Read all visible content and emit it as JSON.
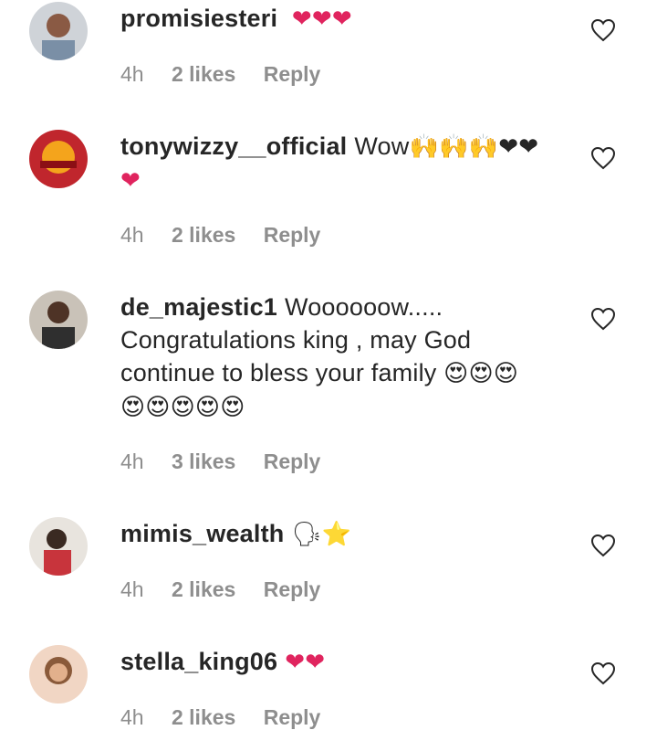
{
  "comments": [
    {
      "username": "promisiesteri",
      "text": "",
      "emoji": "❤❤❤",
      "time": "4h",
      "likes": "2 likes",
      "reply": "Reply"
    },
    {
      "username": "tonywizzy__official",
      "text": "Wow",
      "emoji": "🙌🙌🙌❤❤",
      "emoji_line2": "❤",
      "time": "4h",
      "likes": "2 likes",
      "reply": "Reply"
    },
    {
      "username": "de_majestic1",
      "text": "Woooooow..... Congratulations king , may God continue to bless your family",
      "emoji": "😍😍😍",
      "emoji_line2": "😍😍😍😍😍",
      "time": "4h",
      "likes": "3 likes",
      "reply": "Reply"
    },
    {
      "username": "mimis_wealth",
      "text": "",
      "emoji": "🗣⭐",
      "time": "4h",
      "likes": "2 likes",
      "reply": "Reply"
    },
    {
      "username": "stella_king06",
      "text": "",
      "emoji": "❤❤",
      "time": "4h",
      "likes": "2 likes",
      "reply": "Reply"
    }
  ],
  "icons": {
    "like": "heart-outline-icon"
  },
  "colors": {
    "heart": "#e0245e",
    "meta": "#8e8e8e",
    "text": "#262626"
  }
}
